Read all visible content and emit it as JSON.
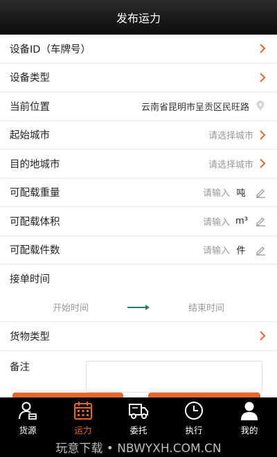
{
  "header": {
    "title": "发布运力"
  },
  "form": {
    "device_id": {
      "label": "设备ID（车牌号）"
    },
    "device_type": {
      "label": "设备类型"
    },
    "location": {
      "label": "当前位置",
      "value": "云南省昆明市呈贡区民旺路"
    },
    "start_city": {
      "label": "起始城市",
      "placeholder": "请选择城市"
    },
    "dest_city": {
      "label": "目的地城市",
      "placeholder": "请选择城市"
    },
    "weight": {
      "label": "可配载重量",
      "placeholder": "请输入",
      "unit": "吨"
    },
    "volume": {
      "label": "可配载体积",
      "placeholder": "请输入",
      "unit": "m³"
    },
    "pieces": {
      "label": "可配载件数",
      "placeholder": "请输入",
      "unit": "件"
    },
    "order_time": {
      "label": "接单时间",
      "start": "开始时间",
      "end": "结束时间"
    },
    "cargo_type": {
      "label": "货物类型"
    },
    "remark": {
      "label": "备注"
    }
  },
  "tabs": [
    {
      "label": "货源",
      "icon": "user-cargo-icon"
    },
    {
      "label": "运力",
      "icon": "calendar-icon"
    },
    {
      "label": "委托",
      "icon": "truck-icon"
    },
    {
      "label": "执行",
      "icon": "clock-icon"
    },
    {
      "label": "我的",
      "icon": "person-icon"
    }
  ],
  "active_tab": "运力",
  "footer": {
    "watermark": "玩意下载 • NBWYXH.COM.CN"
  },
  "colors": {
    "accent": "#e4682a",
    "header": "#1a1a1a",
    "arrow": "#2e7a6a"
  }
}
